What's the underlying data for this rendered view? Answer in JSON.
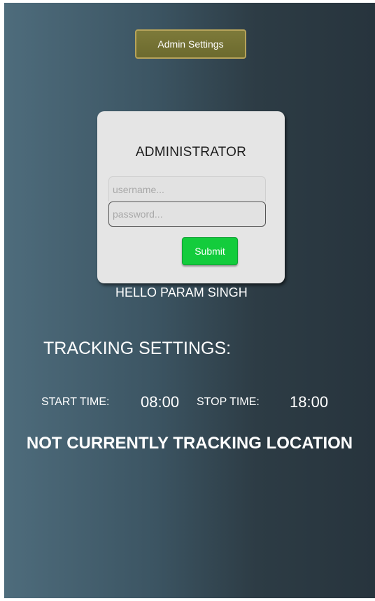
{
  "admin_settings_button": {
    "label": "Admin Settings"
  },
  "login": {
    "title": "ADMINISTRATOR",
    "username": {
      "value": "",
      "placeholder": "username..."
    },
    "password": {
      "value": "",
      "placeholder": "password..."
    },
    "submit_label": "Submit"
  },
  "greeting": "HELLO PARAM SINGH",
  "tracking": {
    "title": "TRACKING SETTINGS:",
    "start_label": "START TIME:",
    "start_value": "08:00",
    "stop_label": "STOP TIME:",
    "stop_value": "18:00",
    "status": "NOT CURRENTLY TRACKING LOCATION"
  },
  "colors": {
    "background_left": "#4e6c7c",
    "background_right": "#27343d",
    "admin_button": "#6c6a2e",
    "submit_button": "#13cc3c"
  }
}
